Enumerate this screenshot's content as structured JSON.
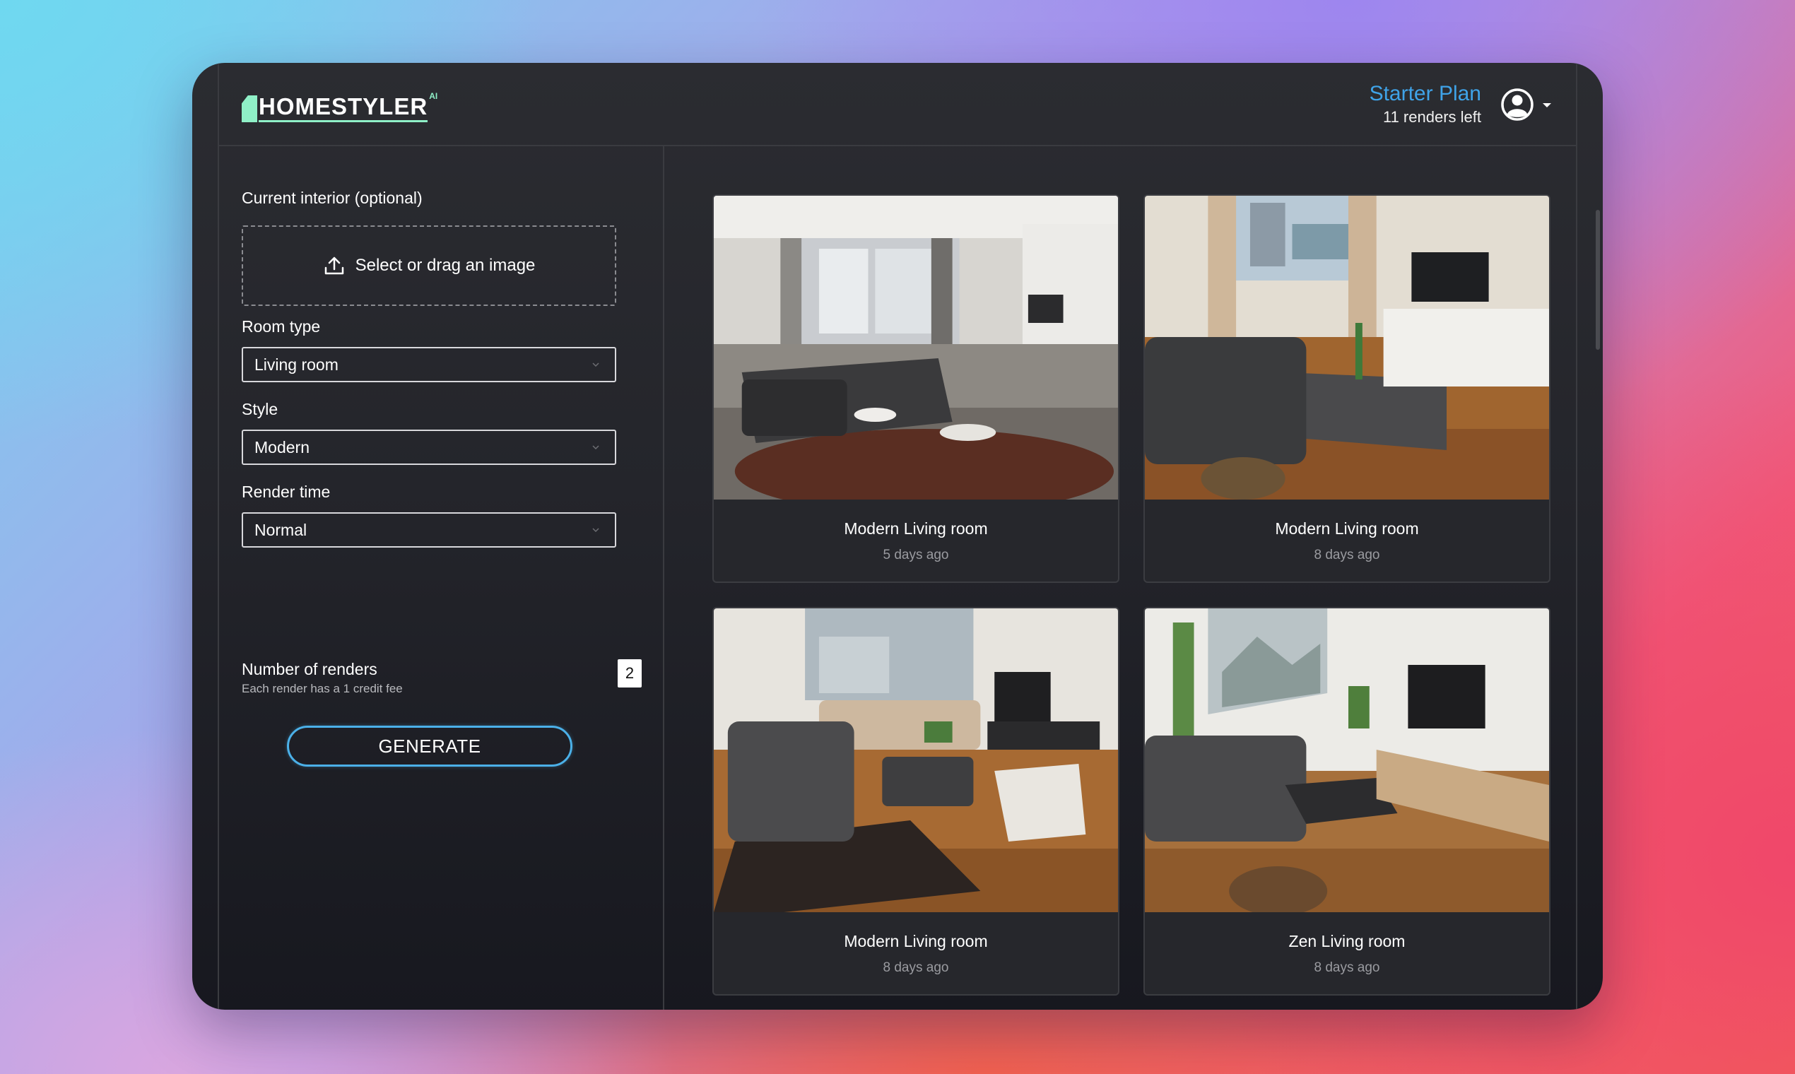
{
  "brand": {
    "name": "HOMESTYLER",
    "badge": "AI"
  },
  "plan": {
    "name": "Starter Plan",
    "renders_left": "11 renders left"
  },
  "form": {
    "current_interior_label": "Current interior (optional)",
    "upload_text": "Select or drag an image",
    "room_type_label": "Room type",
    "room_type_value": "Living room",
    "style_label": "Style",
    "style_value": "Modern",
    "render_time_label": "Render time",
    "render_time_value": "Normal",
    "num_renders_label": "Number of renders",
    "num_renders_hint": "Each render has a 1 credit fee",
    "num_renders_value": "2",
    "generate_label": "GENERATE"
  },
  "gallery": [
    {
      "title": "Modern Living room",
      "date": "5 days ago"
    },
    {
      "title": "Modern Living room",
      "date": "8 days ago"
    },
    {
      "title": "Modern Living room",
      "date": "8 days ago"
    },
    {
      "title": "Zen Living room",
      "date": "8 days ago"
    }
  ],
  "colors": {
    "accent": "#3fa3e8",
    "brand": "#8ff0c7",
    "panel": "#26272c"
  }
}
